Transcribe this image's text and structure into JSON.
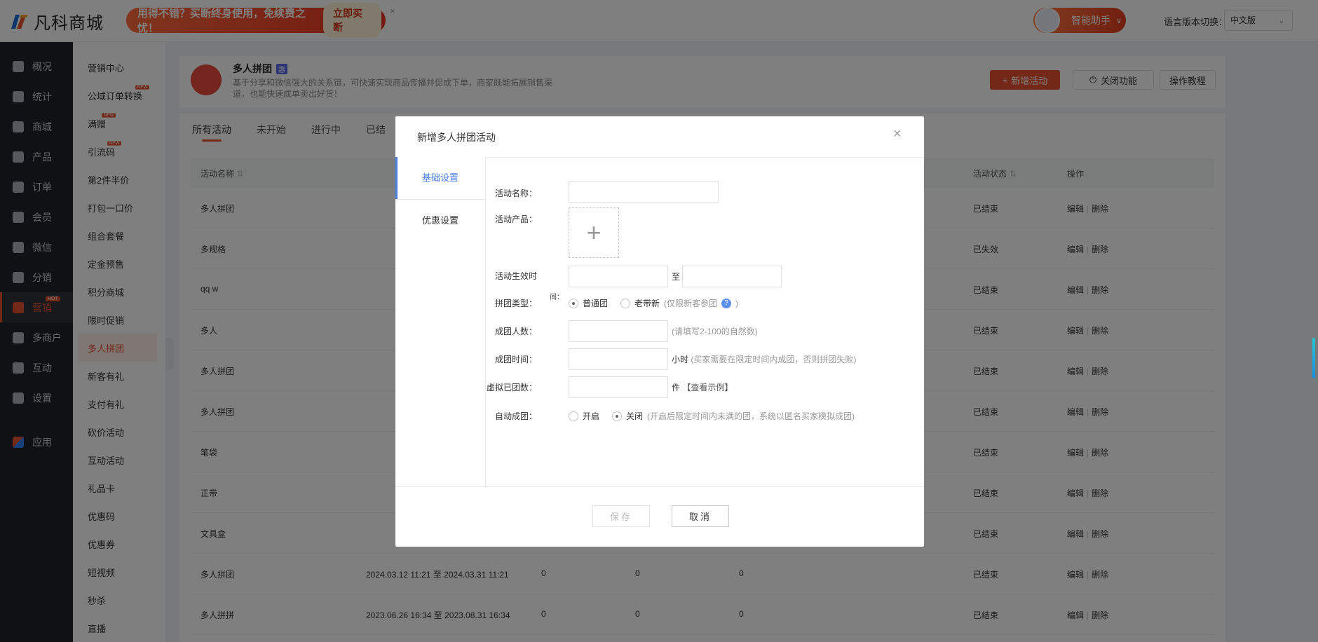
{
  "topbar": {
    "logo_text": "凡科商城",
    "promo_text": "用得不错？买断终身使用，免续费之忧！",
    "promo_button": "立即买断",
    "promo_close": "×",
    "assistant_label": "智能助手",
    "lang_label": "语言版本切换：",
    "lang_value": "中文版"
  },
  "sidebar_main": {
    "items": [
      {
        "label": "概况"
      },
      {
        "label": "统计"
      },
      {
        "label": "商城"
      },
      {
        "label": "产品"
      },
      {
        "label": "订单"
      },
      {
        "label": "会员"
      },
      {
        "label": "微信"
      },
      {
        "label": "分销"
      },
      {
        "label": "营销",
        "badge": "HOT"
      },
      {
        "label": "多商户"
      },
      {
        "label": "互动"
      },
      {
        "label": "设置"
      },
      {
        "label": "应用"
      }
    ]
  },
  "sidebar_sub": {
    "items": [
      {
        "label": "营销中心"
      },
      {
        "label": "公域订单转换",
        "badge": "NEW"
      },
      {
        "label": "满赠",
        "badge": "NEW"
      },
      {
        "label": "引流码",
        "badge": "NEW"
      },
      {
        "label": "第2件半价"
      },
      {
        "label": "打包一口价"
      },
      {
        "label": "组合套餐"
      },
      {
        "label": "定金预售"
      },
      {
        "label": "积分商城"
      },
      {
        "label": "限时促销"
      },
      {
        "label": "多人拼团"
      },
      {
        "label": "新客有礼"
      },
      {
        "label": "支付有礼"
      },
      {
        "label": "砍价活动"
      },
      {
        "label": "互动活动"
      },
      {
        "label": "礼品卡"
      },
      {
        "label": "优惠码"
      },
      {
        "label": "优惠券"
      },
      {
        "label": "短视频"
      },
      {
        "label": "秒杀"
      },
      {
        "label": "直播"
      }
    ]
  },
  "header": {
    "title": "多人拼团",
    "badge": "惠",
    "description": "基于分享和微信强大的关系链，可快速实现商品传播并促成下单，商家既能拓展销售渠道，也能快速成单卖出好货！",
    "add_button": "新增活动",
    "close_button": "关闭功能",
    "guide_button": "操作教程"
  },
  "tabs": [
    "所有活动",
    "未开始",
    "进行中",
    "已结"
  ],
  "table": {
    "columns": {
      "name": "活动名称",
      "status": "活动状态",
      "action": "操作"
    },
    "edit": "编辑",
    "delete": "删除",
    "rows": [
      {
        "name": "多人拼团",
        "time": "",
        "c1": "",
        "c2": "",
        "c3": "",
        "status": "已结束"
      },
      {
        "name": "多规格",
        "time": "",
        "c1": "",
        "c2": "",
        "c3": "",
        "status": "已失效"
      },
      {
        "name": "qq w",
        "time": "",
        "c1": "",
        "c2": "",
        "c3": "",
        "status": "已结束"
      },
      {
        "name": "多人",
        "time": "",
        "c1": "",
        "c2": "",
        "c3": "",
        "status": "已结束"
      },
      {
        "name": "多人拼团",
        "time": "",
        "c1": "",
        "c2": "",
        "c3": "",
        "status": "已结束"
      },
      {
        "name": "多人拼团",
        "time": "",
        "c1": "",
        "c2": "",
        "c3": "",
        "status": "已结束"
      },
      {
        "name": "笔袋",
        "time": "",
        "c1": "",
        "c2": "",
        "c3": "",
        "status": "已结束"
      },
      {
        "name": "正带",
        "time": "",
        "c1": "",
        "c2": "",
        "c3": "",
        "status": "已结束"
      },
      {
        "name": "文具盒",
        "time": "",
        "c1": "",
        "c2": "",
        "c3": "",
        "status": "已结束"
      },
      {
        "name": "多人拼团",
        "time": "2024.03.12 11:21 至 2024.03.31 11:21",
        "c1": "0",
        "c2": "0",
        "c3": "0",
        "status": "已结束"
      },
      {
        "name": "多人拼拼",
        "time": "2023.06.26 16:34 至 2023.08.31 16:34",
        "c1": "0",
        "c2": "0",
        "c3": "0",
        "status": "已结束"
      }
    ]
  },
  "dialog": {
    "title": "新增多人拼团活动",
    "close": "×",
    "nav": [
      "基础设置",
      "优惠设置"
    ],
    "fields": {
      "name_label": "活动名称：",
      "product_label": "活动产品：",
      "upload_plus": "+",
      "time_label": "活动生效时",
      "time_sep": "至",
      "type_label": "拼团类型：",
      "type_marker": "间：",
      "type_opt1": "普通团",
      "type_opt2": "老带新",
      "type_hint": "(仅限新客参团",
      "type_hint_close": ")",
      "type_help": "?",
      "size_label": "成团人数：",
      "size_hint": "(请填写2-100的自然数)",
      "duration_label": "成团时间：",
      "duration_unit": "小时",
      "duration_hint": "(买家需要在限定时间内成团，否则拼团失败)",
      "virtual_label": "虚拟已团数：",
      "virtual_unit": "件",
      "virtual_link": "【查看示例】",
      "auto_label": "自动成团：",
      "auto_opt1": "开启",
      "auto_opt2": "关闭",
      "auto_hint": "(开启后限定时间内未满的团，系统以匿名买家模拟成团)"
    },
    "save": "保存",
    "cancel": "取消"
  }
}
